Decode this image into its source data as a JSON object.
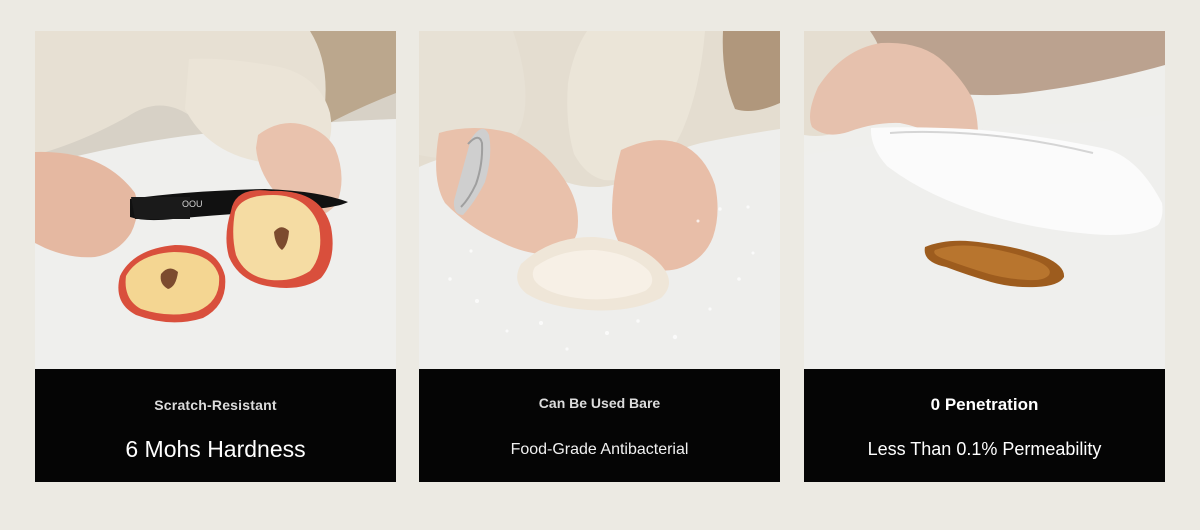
{
  "cards": [
    {
      "title": "Scratch-Resistant",
      "subtitle": "6 Mohs Hardness",
      "knife_brand": "OOU"
    },
    {
      "title": "Can Be Used Bare",
      "subtitle": "Food-Grade Antibacterial"
    },
    {
      "title": "0 Penetration",
      "subtitle": "Less Than 0.1% Permeability"
    }
  ],
  "colors": {
    "page_background": "#eceae3",
    "caption_background": "#050505",
    "caption_text": "#ffffff"
  }
}
